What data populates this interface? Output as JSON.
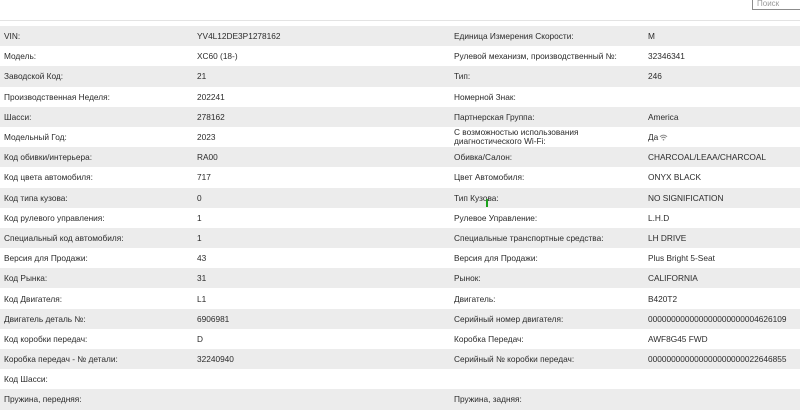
{
  "search": {
    "placeholder": "Поиск"
  },
  "rows": [
    {
      "label1": "VIN:",
      "value1": "YV4L12DE3P1278162",
      "label2": "Единица Измерения Скорости:",
      "value2": "M"
    },
    {
      "label1": "Модель:",
      "value1": "XC60 (18-)",
      "label2": "Рулевой механизм, производственный №:",
      "value2": "32346341"
    },
    {
      "label1": "Заводской Код:",
      "value1": "21",
      "label2": "Тип:",
      "value2": "246"
    },
    {
      "label1": "Производственная Неделя:",
      "value1": "202241",
      "label2": "Номерной Знак:",
      "value2": ""
    },
    {
      "label1": "Шасси:",
      "value1": "278162",
      "label2": "Партнерская Группа:",
      "value2": "America"
    },
    {
      "label1": "Модельный Год:",
      "value1": "2023",
      "label2": "С возможностью использования диагностического Wi-Fi:",
      "value2": "Да"
    },
    {
      "label1": "Код обивки/интерьера:",
      "value1": "RA00",
      "label2": "Обивка/Салон:",
      "value2": "CHARCOAL/LEAA/CHARCOAL"
    },
    {
      "label1": "Код цвета автомобиля:",
      "value1": "717",
      "label2": "Цвет Автомобиля:",
      "value2": "ONYX BLACK"
    },
    {
      "label1": "Код типа кузова:",
      "value1": "0",
      "label2": "Тип Кузова:",
      "value2": "NO SIGNIFICATION"
    },
    {
      "label1": "Код рулевого управления:",
      "value1": "1",
      "label2": "Рулевое Управление:",
      "value2": "L.H.D"
    },
    {
      "label1": "Специальный код автомобиля:",
      "value1": "1",
      "label2": "Специальные транспортные средства:",
      "value2": "LH DRIVE"
    },
    {
      "label1": "Версия для Продажи:",
      "value1": "43",
      "label2": "Версия для Продажи:",
      "value2": "Plus Bright 5-Seat"
    },
    {
      "label1": "Код Рынка:",
      "value1": "31",
      "label2": "Рынок:",
      "value2": "CALIFORNIA"
    },
    {
      "label1": "Код Двигателя:",
      "value1": "L1",
      "label2": "Двигатель:",
      "value2": "B420T2"
    },
    {
      "label1": "Двигатель деталь №:",
      "value1": "6906981",
      "label2": "Серийный номер двигателя:",
      "value2": "000000000000000000000004626109"
    },
    {
      "label1": "Код коробки передач:",
      "value1": "D",
      "label2": "Коробка Передач:",
      "value2": "AWF8G45 FWD"
    },
    {
      "label1": "Коробка передач - № детали:",
      "value1": "32240940",
      "label2": "Серийный № коробки передач:",
      "value2": "000000000000000000000022646855"
    },
    {
      "label1": "Код Шасси:",
      "value1": "",
      "label2": "",
      "value2": ""
    },
    {
      "label1": "Пружина, передняя:",
      "value1": "",
      "label2": "Пружина, задняя:",
      "value2": ""
    }
  ]
}
